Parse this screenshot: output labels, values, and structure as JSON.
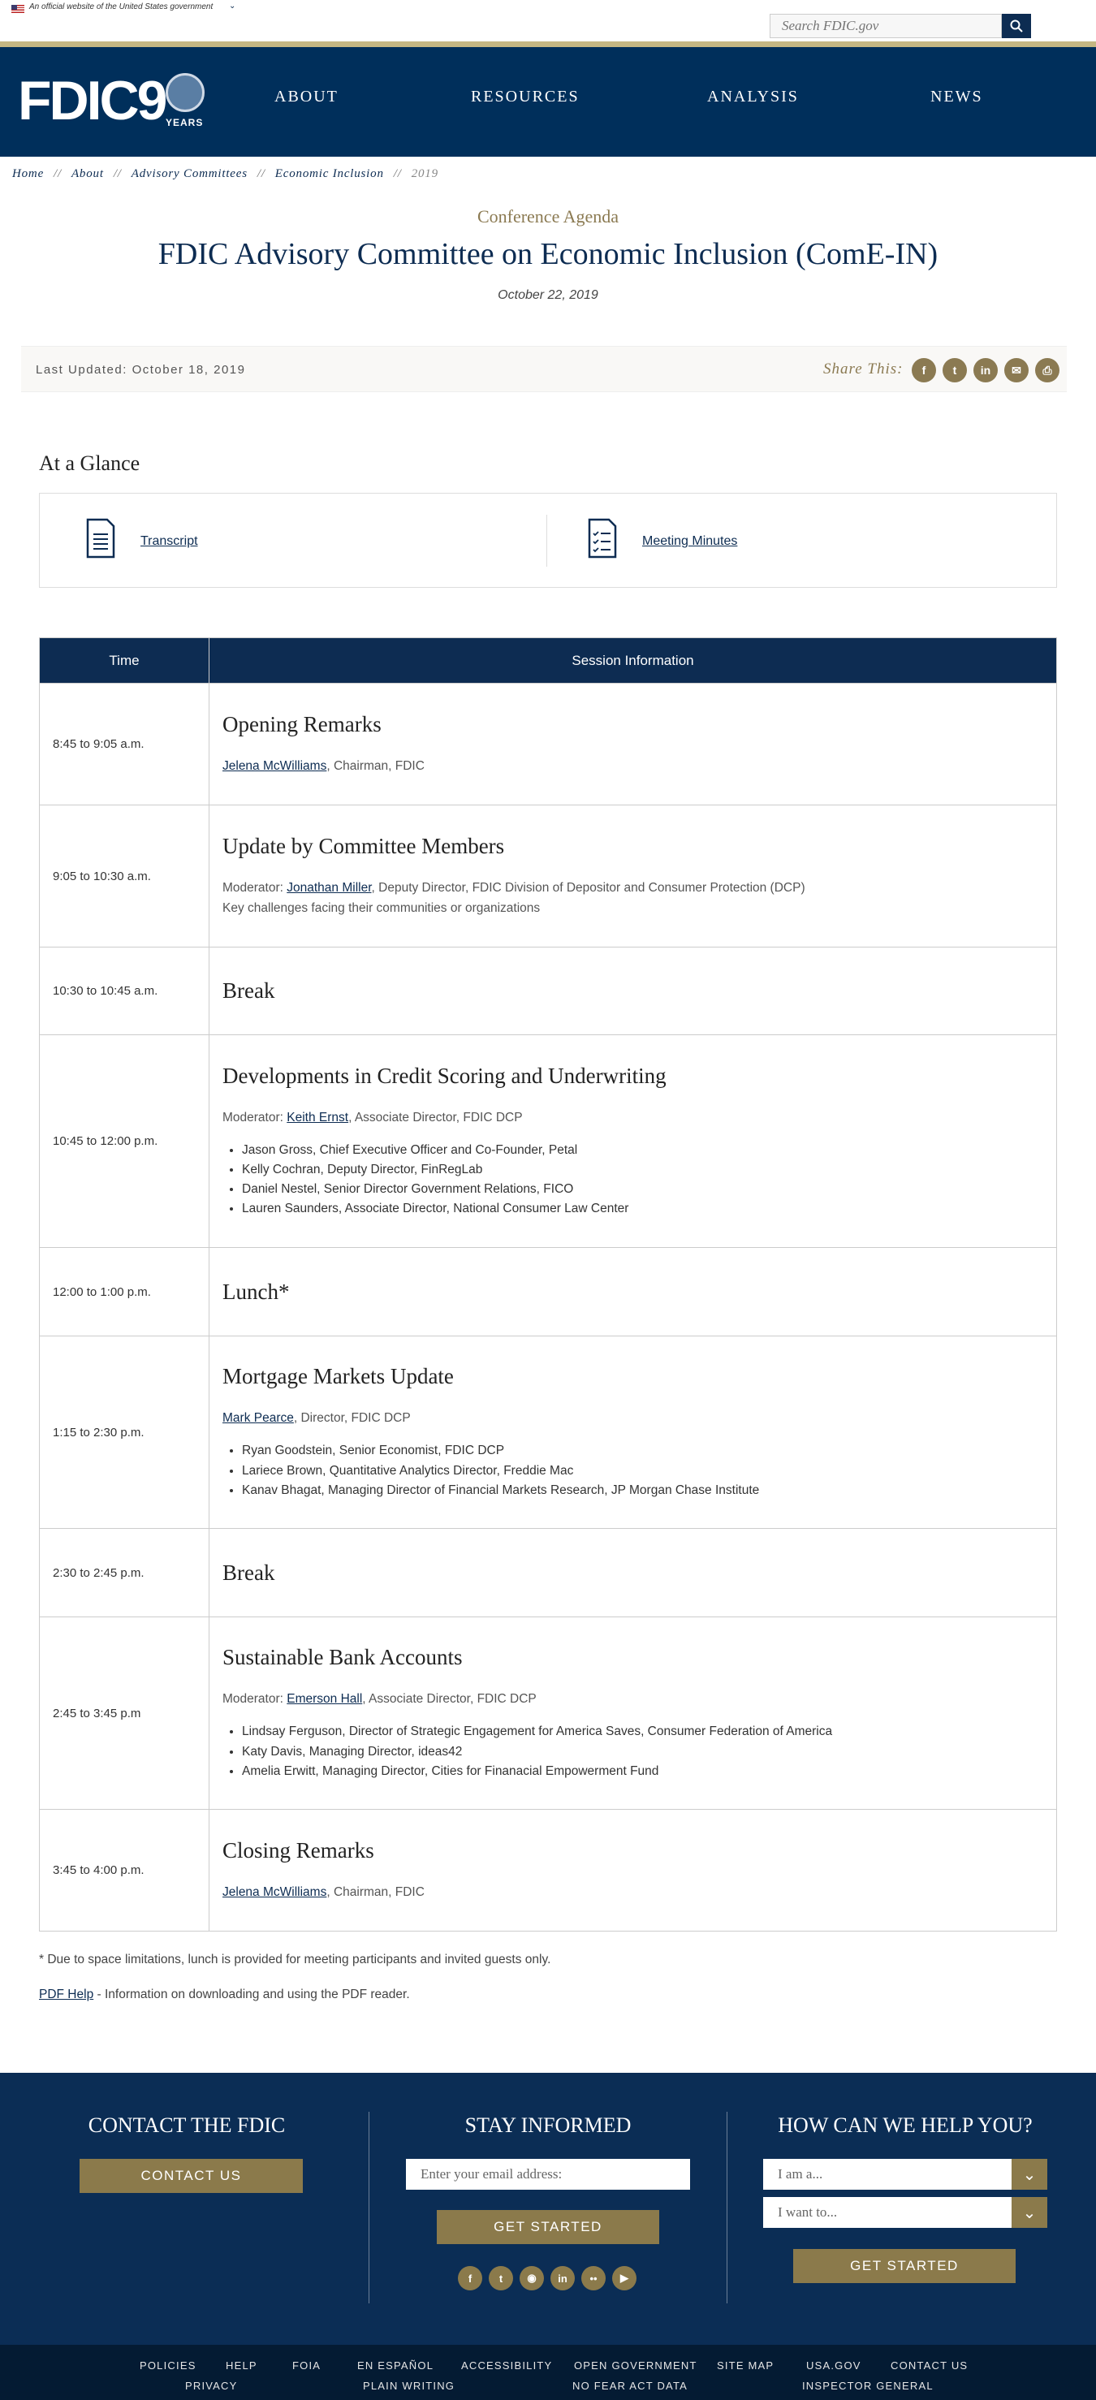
{
  "gov_banner": {
    "official_text": "An official website of the United States government"
  },
  "search": {
    "placeholder": "Search FDIC.gov"
  },
  "logo": {
    "text": "FDIC9",
    "years": "YEARS"
  },
  "nav": [
    "ABOUT",
    "RESOURCES",
    "ANALYSIS",
    "NEWS"
  ],
  "breadcrumb": [
    "Home",
    "About",
    "Advisory Committees",
    "Economic Inclusion"
  ],
  "breadcrumb_current": "2019",
  "breadcrumb_sep": "//",
  "page": {
    "eyebrow": "Conference Agenda",
    "title": "FDIC Advisory Committee on Economic Inclusion (ComE-IN)",
    "date": "October 22, 2019"
  },
  "last_updated": "Last Updated: October 18, 2019",
  "share_label": "Share This:",
  "share_icons": [
    "facebook-icon",
    "twitter-icon",
    "linkedin-icon",
    "email-icon",
    "print-icon"
  ],
  "glance": {
    "title": "At a Glance",
    "transcript": "Transcript",
    "minutes": "Meeting Minutes"
  },
  "agenda": {
    "headers": [
      "Time",
      "Session Information"
    ],
    "rows": [
      {
        "time": "8:45 to 9:05 a.m.",
        "title": "Opening Remarks",
        "lines": [
          {
            "prefix": "",
            "link": "Jelena McWilliams",
            "suffix": ", Chairman, FDIC"
          }
        ],
        "list": []
      },
      {
        "time": "9:05 to 10:30 a.m.",
        "title": "Update by Committee Members",
        "lines": [
          {
            "prefix": "Moderator: ",
            "link": "Jonathan Miller",
            "suffix": ", Deputy Director, FDIC Division of Depositor and Consumer Protection (DCP)"
          },
          {
            "prefix": "Key challenges facing their communities or organizations",
            "link": "",
            "suffix": ""
          }
        ],
        "list": []
      },
      {
        "time": "10:30 to 10:45 a.m.",
        "title": "Break",
        "lines": [],
        "list": []
      },
      {
        "time": "10:45 to 12:00 p.m.",
        "title": "Developments in Credit Scoring and Underwriting",
        "lines": [
          {
            "prefix": "Moderator: ",
            "link": "Keith Ernst",
            "suffix": ", Associate Director, FDIC DCP"
          }
        ],
        "list": [
          "Jason Gross, Chief Executive Officer and Co-Founder, Petal",
          "Kelly Cochran, Deputy Director, FinRegLab",
          "Daniel Nestel, Senior Director Government Relations, FICO",
          "Lauren Saunders, Associate Director, National Consumer Law Center"
        ]
      },
      {
        "time": "12:00 to 1:00 p.m.",
        "title": "Lunch*",
        "lines": [],
        "list": []
      },
      {
        "time": "1:15 to 2:30 p.m.",
        "title": "Mortgage Markets Update",
        "lines": [
          {
            "prefix": "",
            "link": "Mark Pearce",
            "suffix": ", Director, FDIC DCP"
          }
        ],
        "list": [
          "Ryan Goodstein, Senior Economist, FDIC DCP",
          "Lariece Brown, Quantitative Analytics Director, Freddie Mac",
          "Kanav Bhagat, Managing Director of Financial Markets Research, JP Morgan Chase Institute"
        ]
      },
      {
        "time": "2:30 to 2:45 p.m.",
        "title": "Break",
        "lines": [],
        "list": []
      },
      {
        "time": "2:45 to 3:45 p.m",
        "title": "Sustainable Bank Accounts",
        "lines": [
          {
            "prefix": "Moderator: ",
            "link": "Emerson Hall",
            "suffix": ", Associate Director, FDIC DCP"
          }
        ],
        "list": [
          "Lindsay Ferguson, Director of Strategic Engagement for America Saves, Consumer Federation of America",
          "Katy Davis, Managing Director, ideas42",
          "Amelia Erwitt, Managing Director, Cities for Finanacial Empowerment Fund"
        ]
      },
      {
        "time": "3:45 to 4:00 p.m.",
        "title": "Closing Remarks",
        "lines": [
          {
            "prefix": "",
            "link": "Jelena McWilliams",
            "suffix": ", Chairman, FDIC"
          }
        ],
        "list": []
      }
    ]
  },
  "footnote": "* Due to space limitations, lunch is provided for meeting participants and invited guests only.",
  "pdf_help": {
    "link": "PDF Help",
    "text": " - Information on downloading and using the PDF reader."
  },
  "footer": {
    "contact_heading": "CONTACT THE FDIC",
    "contact_button": "CONTACT US",
    "stay_heading": "STAY INFORMED",
    "email_placeholder": "Enter your email address:",
    "stay_button": "GET STARTED",
    "help_heading": "HOW CAN WE HELP YOU?",
    "select_1": "I am a...",
    "select_2": "I want to...",
    "help_button": "GET STARTED",
    "social": [
      "facebook-icon",
      "twitter-icon",
      "instagram-icon",
      "linkedin-icon",
      "flickr-icon",
      "youtube-icon"
    ]
  },
  "bottom_links": {
    "row1": [
      "POLICIES",
      "HELP",
      "FOIA",
      "EN ESPAÑOL",
      "ACCESSIBILITY",
      "OPEN GOVERNMENT",
      "SITE MAP",
      "USA.GOV",
      "CONTACT US"
    ],
    "row2": [
      "PRIVACY",
      "PLAIN WRITING",
      "NO FEAR ACT DATA",
      "INSPECTOR GENERAL"
    ]
  },
  "colors": {
    "navy": "#0d2c52",
    "gold": "#8b7a4b",
    "footer_bg": "#0b2d55"
  }
}
